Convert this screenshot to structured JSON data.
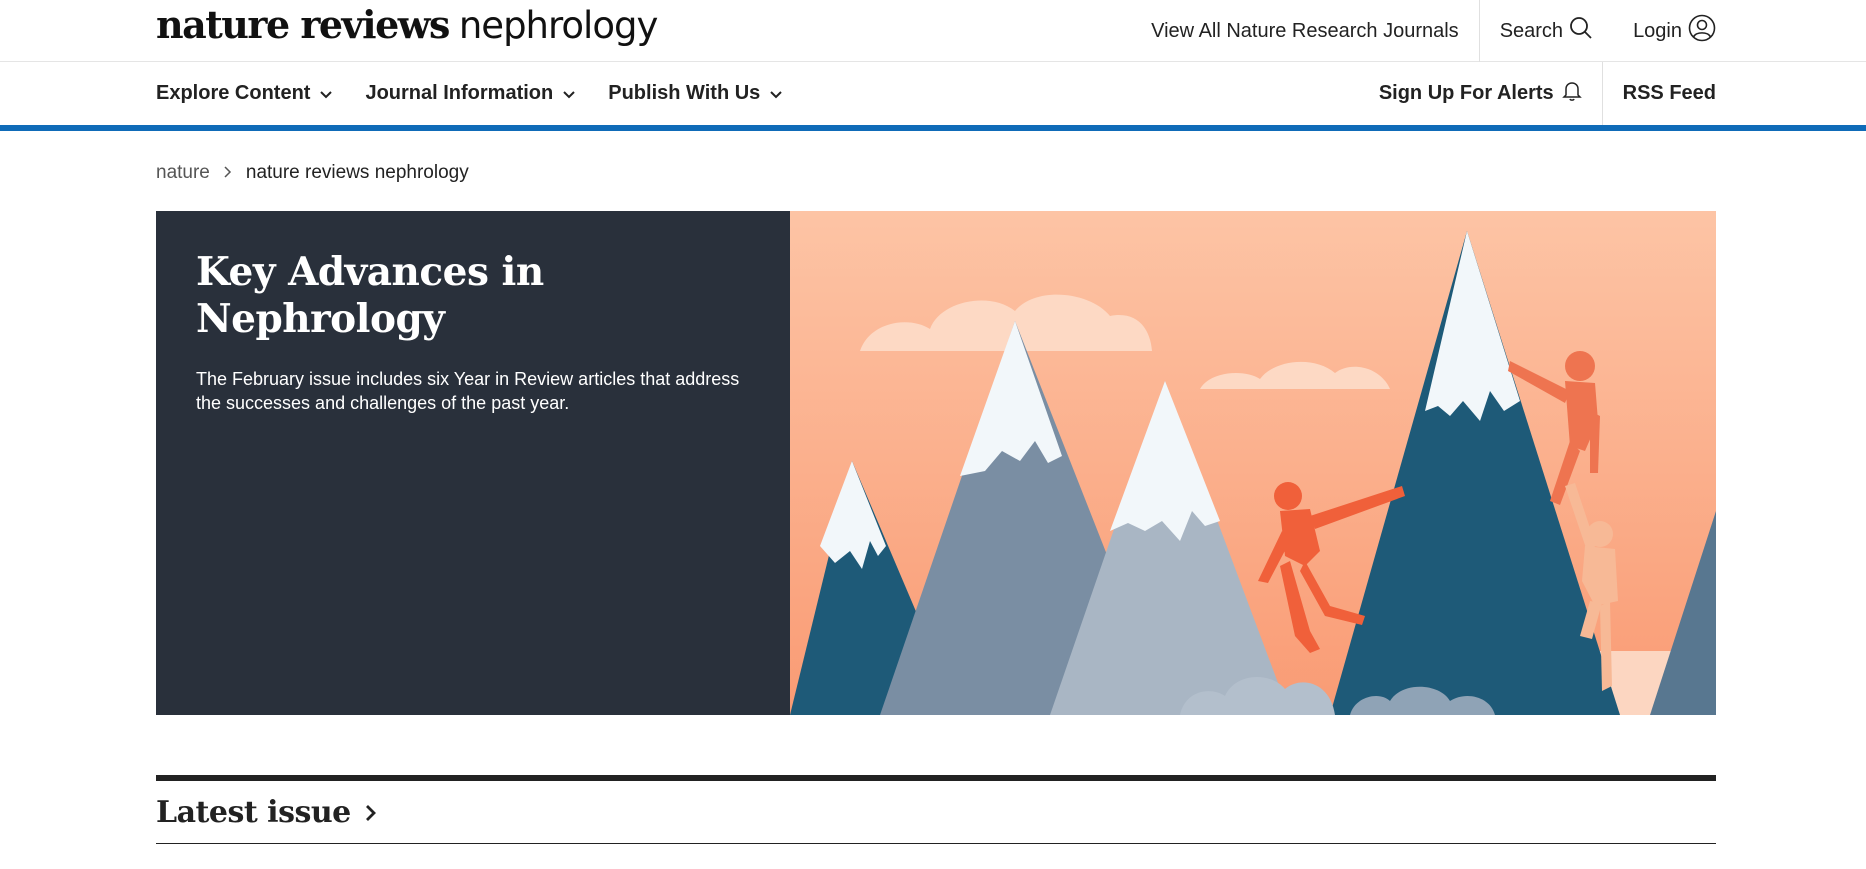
{
  "header": {
    "logo_bold": "nature reviews",
    "logo_light": "nephrology",
    "view_all_journals": "View All Nature Research Journals",
    "search_label": "Search",
    "login_label": "Login"
  },
  "nav": {
    "items": [
      {
        "label": "Explore Content"
      },
      {
        "label": "Journal Information"
      },
      {
        "label": "Publish With Us"
      }
    ],
    "alerts_label": "Sign Up For Alerts",
    "rss_label": "RSS Feed"
  },
  "breadcrumb": {
    "root": "nature",
    "current": "nature reviews nephrology"
  },
  "hero": {
    "title": "Key Advances in Nephrology",
    "description": "The February issue includes six Year in Review articles that address the successes and challenges of the past year."
  },
  "latest": {
    "title": "Latest issue"
  },
  "colors": {
    "accent_blue": "#0f6bb8",
    "hero_dark": "#29303b",
    "hero_sky": "#fcbf9f"
  }
}
